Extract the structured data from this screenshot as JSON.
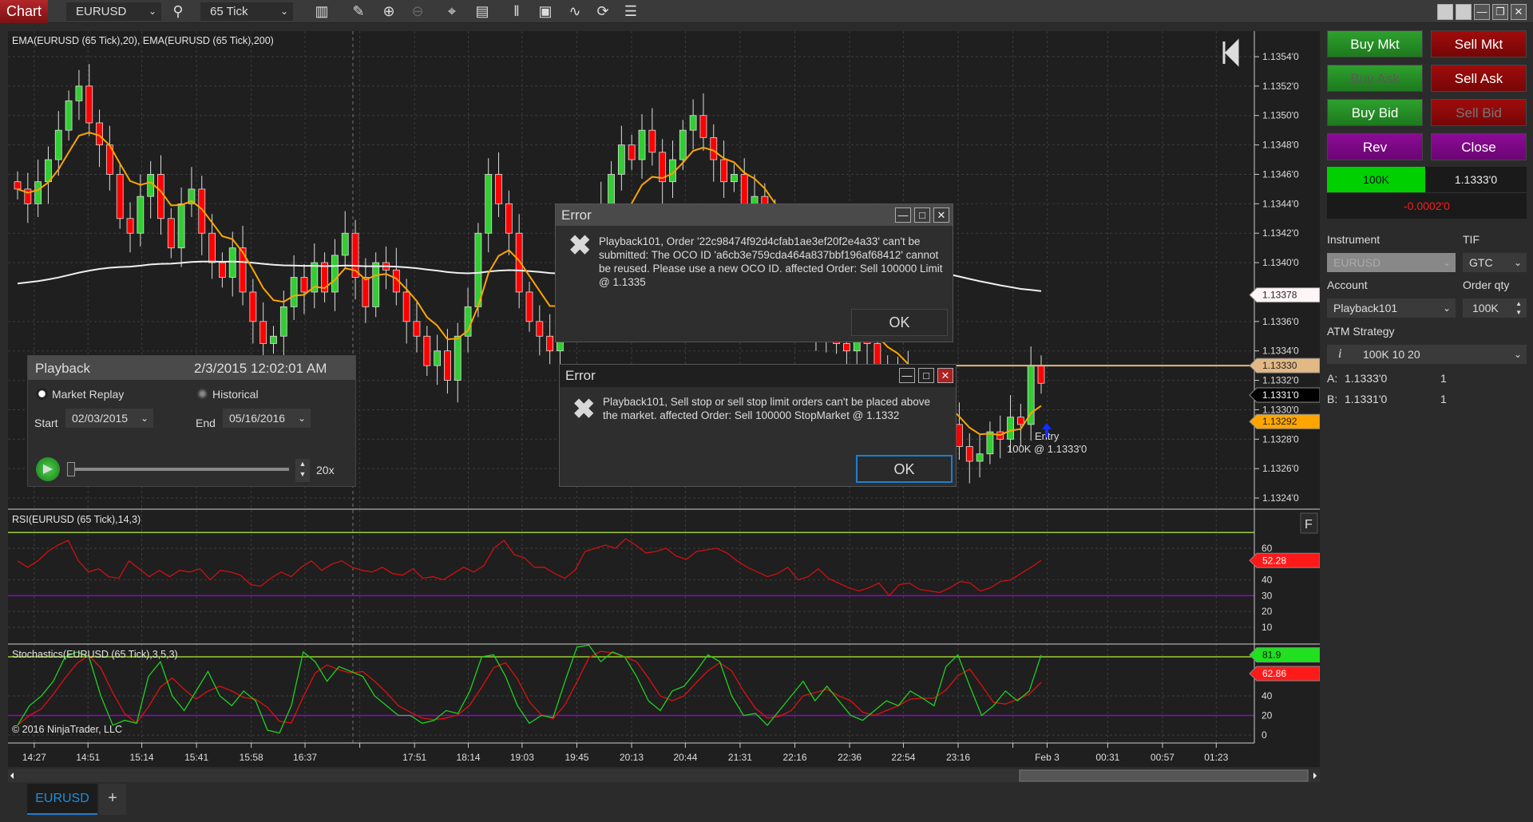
{
  "toolbar": {
    "chart_label": "Chart",
    "instrument": "EURUSD",
    "interval": "65 Tick",
    "icons": [
      "bar-type-icon",
      "pencil-icon",
      "zoom-in-icon",
      "zoom-out-icon",
      "crosshair-icon",
      "data-box-icon",
      "right-margin-icon",
      "overlay-icon",
      "strategy-icon",
      "reload-icon",
      "properties-icon"
    ]
  },
  "price_panel": {
    "title": "EMA(EURUSD (65 Tick),20), EMA(EURUSD (65 Tick),200)",
    "axis_labels": [
      "1.1354'0",
      "1.1352'0",
      "1.1350'0",
      "1.1348'0",
      "1.1346'0",
      "1.1344'0",
      "1.1342'0",
      "1.1340'0",
      "1.1336'0",
      "1.1334'0",
      "1.1332'0",
      "1.1330'0",
      "1.1328'0",
      "1.1326'0",
      "1.1324'0"
    ],
    "axis_values": [
      1.1354,
      1.1352,
      1.135,
      1.1348,
      1.1346,
      1.1344,
      1.1342,
      1.134,
      1.1336,
      1.1334,
      1.1332,
      1.133,
      1.1328,
      1.1326,
      1.1324
    ],
    "tags": [
      {
        "label": "1.13378",
        "value": 1.13378,
        "bg": "#fff5f7",
        "fg": "#222"
      },
      {
        "label": "1.13330",
        "value": 1.1333,
        "bg": "#e2b985",
        "fg": "#222"
      },
      {
        "label": "1.1331'0",
        "value": 1.1331,
        "bg": "#000000",
        "fg": "#ffffff"
      },
      {
        "label": "1.13292",
        "value": 1.13292,
        "bg": "#ffa500",
        "fg": "#222"
      }
    ],
    "position_line_price": 1.1333,
    "entry_label": "Entry",
    "entry_detail": "100K @ 1.1333'0",
    "closes": [
      1.1345,
      1.1344,
      1.13455,
      1.1347,
      1.1349,
      1.1351,
      1.1352,
      1.13495,
      1.1348,
      1.1346,
      1.1343,
      1.1342,
      1.13445,
      1.1346,
      1.1343,
      1.1341,
      1.1344,
      1.1345,
      1.1342,
      1.134,
      1.1339,
      1.1341,
      1.1338,
      1.1336,
      1.13345,
      1.1335,
      1.1337,
      1.1339,
      1.1338,
      1.134,
      1.1338,
      1.13405,
      1.1342,
      1.1339,
      1.1337,
      1.134,
      1.13395,
      1.1338,
      1.1336,
      1.1335,
      1.1333,
      1.1334,
      1.1332,
      1.1335,
      1.1337,
      1.1342,
      1.1346,
      1.1344,
      1.1342,
      1.1338,
      1.1336,
      1.1335,
      1.1334,
      1.1337,
      1.1339,
      1.1338,
      1.1341,
      1.1344,
      1.1346,
      1.1348,
      1.1347,
      1.1349,
      1.13475,
      1.13455,
      1.1347,
      1.1349,
      1.135,
      1.13485,
      1.1347,
      1.13455,
      1.1346,
      1.1344,
      1.13445,
      1.1343,
      1.1341,
      1.134,
      1.1338,
      1.1337,
      1.13355,
      1.1335,
      1.13345,
      1.1334,
      1.1335,
      1.13345,
      1.1333,
      1.1332,
      1.13325,
      1.1331,
      1.133,
      1.1329,
      1.1328,
      1.1329,
      1.13275,
      1.13265,
      1.1327,
      1.13285,
      1.1328,
      1.13295,
      1.1329,
      1.1333,
      1.13318
    ],
    "colors": {
      "up": "#32cd32",
      "down": "#ff0000",
      "ema_fast": "#ffa500",
      "ema_slow": "#f0f0f0"
    }
  },
  "rsi_panel": {
    "title": "RSI(EURUSD (65 Tick),14,3)",
    "axis_labels": [
      "60",
      "40",
      "30",
      "20",
      "10"
    ],
    "axis_values": [
      60,
      40,
      30,
      20,
      10
    ],
    "upper": 70,
    "lower": 30,
    "current_label": "52.28",
    "values": [
      52,
      48,
      52,
      58,
      62,
      65,
      52,
      45,
      47,
      42,
      41,
      52,
      47,
      42,
      46,
      42,
      46,
      45,
      47,
      40,
      46,
      45,
      43,
      37,
      36,
      41,
      45,
      42,
      48,
      52,
      46,
      50,
      52,
      48,
      46,
      45,
      48,
      44,
      43,
      47,
      41,
      42,
      40,
      44,
      48,
      45,
      49,
      60,
      65,
      56,
      54,
      48,
      48,
      44,
      41,
      46,
      58,
      60,
      62,
      60,
      66,
      62,
      57,
      58,
      60,
      55,
      53,
      58,
      59,
      60,
      57,
      52,
      48,
      45,
      42,
      44,
      48,
      40,
      42,
      47,
      41,
      38,
      35,
      33,
      35,
      38,
      30,
      37,
      38,
      34,
      33,
      32,
      35,
      39,
      38,
      33,
      35,
      39,
      40,
      44,
      48,
      52.28
    ],
    "f_button": "F"
  },
  "stoch_panel": {
    "title": "Stochastics(EURUSD (65 Tick),3,5,3)",
    "axis_labels": [
      "40",
      "20",
      "0"
    ],
    "axis_values": [
      40,
      20,
      0
    ],
    "upper": 80,
    "lower": 20,
    "k_label": "81.9",
    "d_label": "62.86",
    "k_values": [
      10,
      30,
      40,
      55,
      80,
      85,
      80,
      40,
      10,
      15,
      12,
      60,
      75,
      40,
      25,
      45,
      65,
      40,
      30,
      45,
      35,
      5,
      2,
      30,
      85,
      75,
      55,
      70,
      65,
      60,
      40,
      30,
      20,
      20,
      12,
      15,
      25,
      22,
      45,
      80,
      82,
      60,
      30,
      12,
      20,
      18,
      55,
      90,
      92,
      75,
      85,
      80,
      60,
      35,
      25,
      45,
      50,
      65,
      82,
      75,
      40,
      20,
      22,
      10,
      25,
      40,
      55,
      35,
      50,
      35,
      20,
      15,
      25,
      35,
      30,
      45,
      38,
      30,
      70,
      82,
      50,
      20,
      30,
      45,
      35,
      45,
      81.9
    ],
    "copyright": "© 2016 NinjaTrader, LLC"
  },
  "time_axis": [
    "14:27",
    "14:51",
    "15:14",
    "15:41",
    "15:58",
    "16:37",
    "",
    "17:51",
    "18:14",
    "19:03",
    "19:45",
    "20:13",
    "20:44",
    "21:31",
    "22:16",
    "22:36",
    "22:54",
    "23:16",
    "",
    "Feb 3",
    "00:31",
    "00:57",
    "01:23"
  ],
  "playback": {
    "title": "Playback",
    "datetime": "2/3/2015 12:02:01 AM",
    "mode_market_replay": "Market Replay",
    "mode_historical": "Historical",
    "selected_mode": "Market Replay",
    "start_label": "Start",
    "start_date": "02/03/2015",
    "end_label": "End",
    "end_date": "05/16/2016",
    "speed": "20x",
    "progress": 0
  },
  "dialogs": [
    {
      "title": "Error",
      "message": "Playback101, Order '22c98474f92d4cfab1ae3ef20f2e4a33' can't be submitted: The OCO ID 'a6cb3e759cda464a837bbf196af68412' cannot be reused. Please use a new OCO ID. affected Order: Sell 100000 Limit @ 1.1335",
      "ok": "OK"
    },
    {
      "title": "Error",
      "message": "Playback101, Sell stop or sell stop limit orders can't be placed above the market. affected Order: Sell 100000 StopMarket @ 1.1332",
      "ok": "OK"
    }
  ],
  "order_panel": {
    "buy_mkt": "Buy Mkt",
    "sell_mkt": "Sell Mkt",
    "buy_ask": "Buy Ask",
    "sell_ask": "Sell Ask",
    "buy_bid": "Buy Bid",
    "sell_bid": "Sell Bid",
    "rev": "Rev",
    "close": "Close",
    "position_qty": "100K",
    "position_price": "1.1333'0",
    "pnl": "-0.0002'0",
    "instrument_label": "Instrument",
    "instrument": "EURUSD",
    "tif_label": "TIF",
    "tif": "GTC",
    "account_label": "Account",
    "account": "Playback101",
    "qty_label": "Order qty",
    "qty": "100K",
    "atm_label": "ATM Strategy",
    "atm": "100K 10 20",
    "ask_label": "A:",
    "ask": "1.1333'0",
    "ask_count": "1",
    "bid_label": "B:",
    "bid": "1.1331'0",
    "bid_count": "1"
  },
  "tabs": [
    {
      "label": "EURUSD",
      "active": true
    }
  ],
  "add_tab": "+"
}
